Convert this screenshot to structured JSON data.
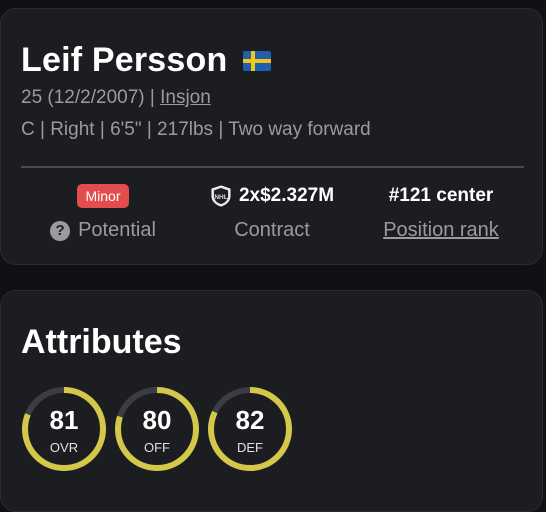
{
  "player": {
    "name": "Leif Persson",
    "flag_icon": "sweden-flag-icon",
    "age_dob": "25 (12/2/2007) | ",
    "team": "Insjon",
    "details": "C | Right | 6'5\" | 217lbs | Two way forward"
  },
  "summary": {
    "potential_badge": "Minor",
    "potential_label": "Potential",
    "contract_value": "2x$2.327M",
    "contract_label": "Contract",
    "rank_value": "#121 center",
    "rank_label": "Position rank"
  },
  "attributes": {
    "title": "Attributes",
    "gauges": [
      {
        "value": "81",
        "label": "OVR",
        "fraction": 0.81
      },
      {
        "value": "80",
        "label": "OFF",
        "fraction": 0.8
      },
      {
        "value": "82",
        "label": "DEF",
        "fraction": 0.82
      }
    ]
  },
  "colors": {
    "gauge_fill": "#d4c84a",
    "gauge_track": "#3c3d42",
    "badge_minor": "#e44d4d"
  }
}
